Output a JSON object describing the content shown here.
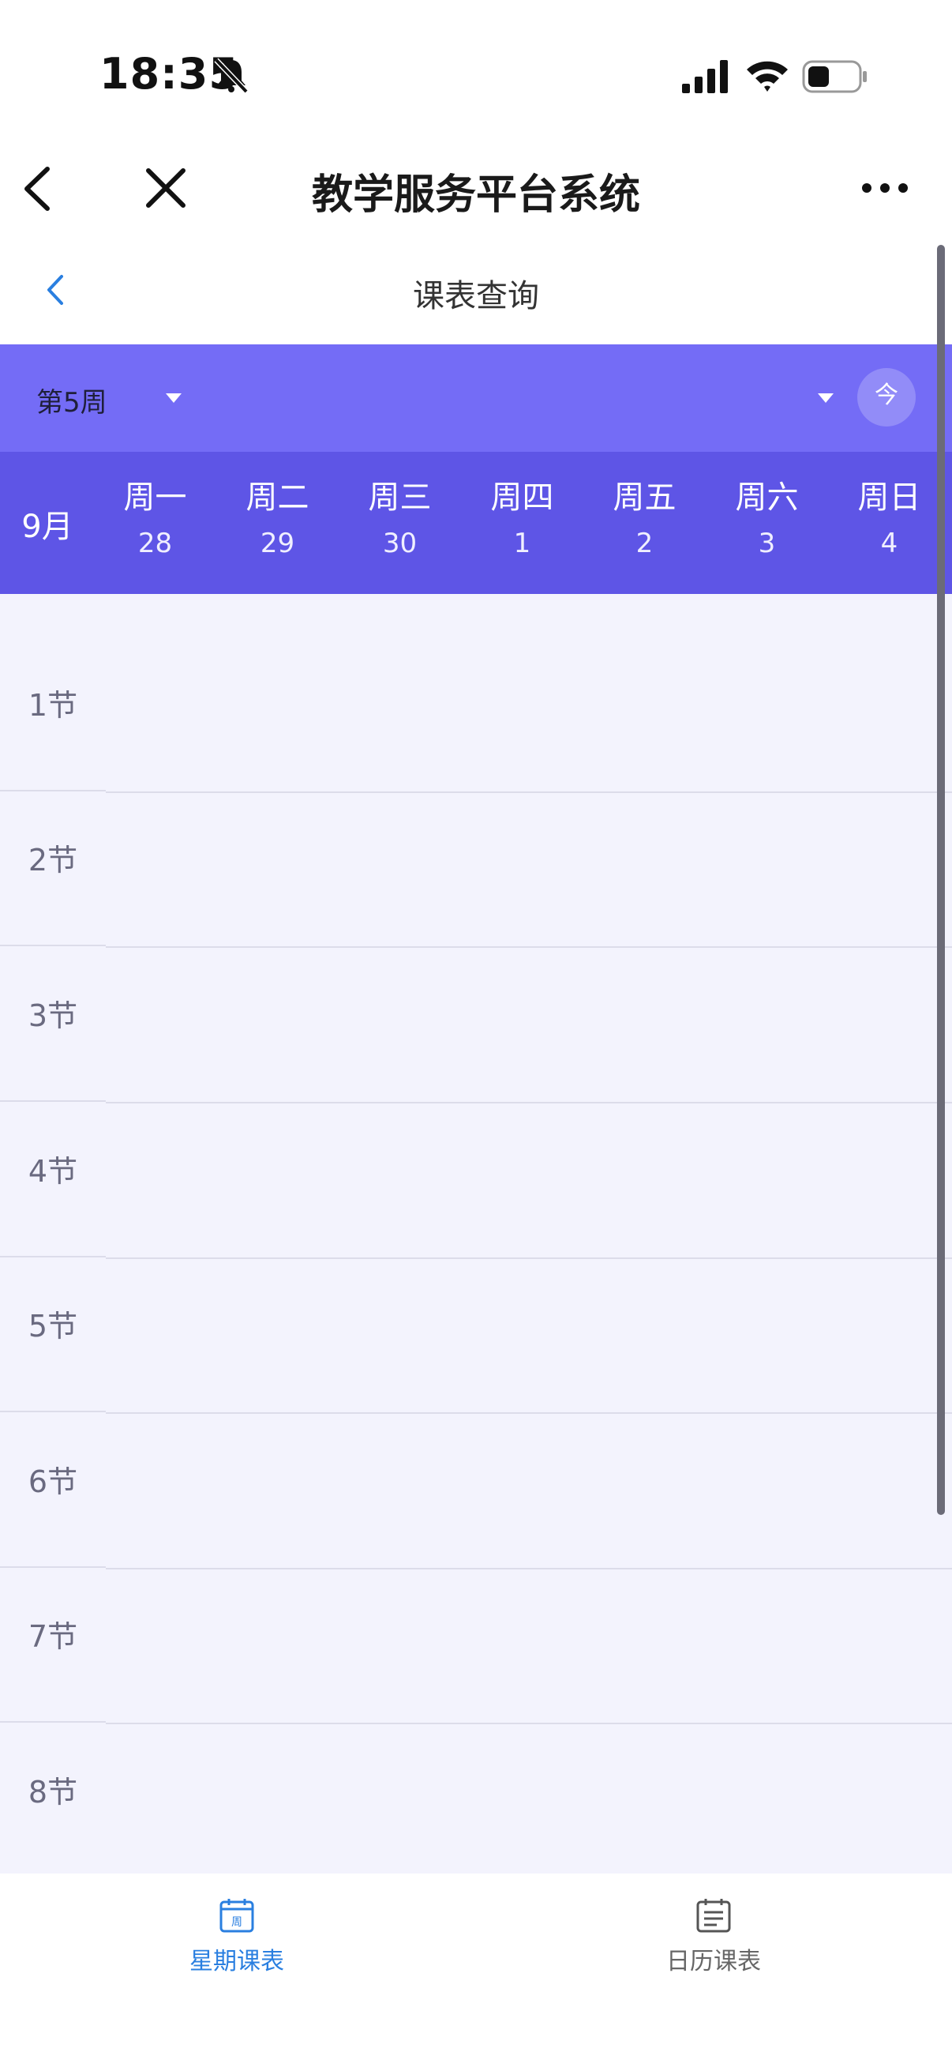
{
  "status_bar": {
    "time": "18:35"
  },
  "nav": {
    "title": "教学服务平台系统"
  },
  "page": {
    "title": "课表查询"
  },
  "week_bar": {
    "week_label": "第5周",
    "today_button": "今"
  },
  "day_header": {
    "month": "9月",
    "days": [
      {
        "name": "周一",
        "date": "28"
      },
      {
        "name": "周二",
        "date": "29"
      },
      {
        "name": "周三",
        "date": "30"
      },
      {
        "name": "周四",
        "date": "1"
      },
      {
        "name": "周五",
        "date": "2"
      },
      {
        "name": "周六",
        "date": "3"
      },
      {
        "name": "周日",
        "date": "4"
      }
    ]
  },
  "periods": [
    "1节",
    "2节",
    "3节",
    "4节",
    "5节",
    "6节",
    "7节",
    "8节"
  ],
  "tabs": [
    {
      "label": "星期课表",
      "icon_glyph": "周",
      "active": true
    },
    {
      "label": "日历课表",
      "active": false
    }
  ],
  "colors": {
    "accent": "#2a7fe0",
    "week_bar": "#746cf6",
    "day_header": "#5e55e6",
    "grid_bg": "#f3f3fd"
  }
}
